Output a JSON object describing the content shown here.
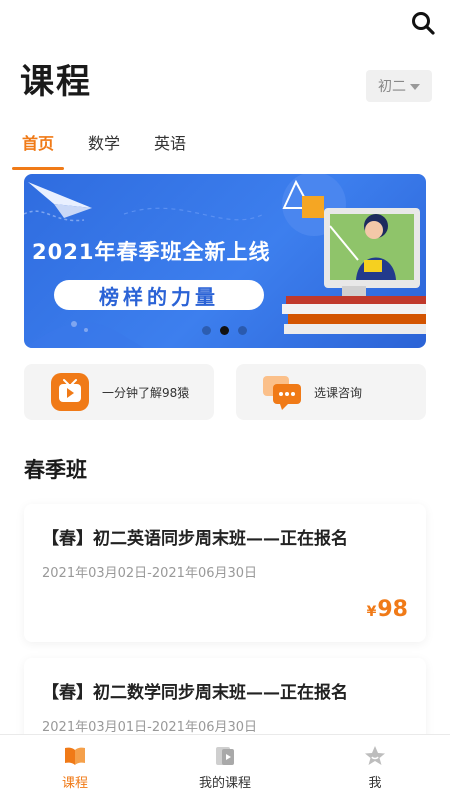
{
  "header": {
    "title": "课程",
    "grade_selected": "初二",
    "search_icon": "search-icon"
  },
  "tabs": [
    {
      "label": "首页",
      "active": true
    },
    {
      "label": "数学",
      "active": false
    },
    {
      "label": "英语",
      "active": false
    }
  ],
  "banner": {
    "headline": "2021年春季班全新上线",
    "pill_text": "榜样的力量",
    "slide_count": 3,
    "active_slide": 1
  },
  "quick_actions": [
    {
      "label": "一分钟了解98猿",
      "icon": "tv-play-icon"
    },
    {
      "label": "选课咨询",
      "icon": "chat-bubble-icon"
    }
  ],
  "section": {
    "title": "春季班"
  },
  "courses": [
    {
      "title": "【春】初二英语同步周末班——正在报名",
      "dates": "2021年03月02日-2021年06月30日",
      "price_symbol": "¥",
      "price": "98"
    },
    {
      "title": "【春】初二数学同步周末班——正在报名",
      "dates": "2021年03月01日-2021年06月30日"
    }
  ],
  "bottom_nav": [
    {
      "label": "课程",
      "icon": "book-icon",
      "active": true
    },
    {
      "label": "我的课程",
      "icon": "my-courses-icon",
      "active": false
    },
    {
      "label": "我",
      "icon": "star-profile-icon",
      "active": false
    }
  ],
  "colors": {
    "accent": "#f07a17",
    "banner_blue": "#2f6cdf"
  }
}
